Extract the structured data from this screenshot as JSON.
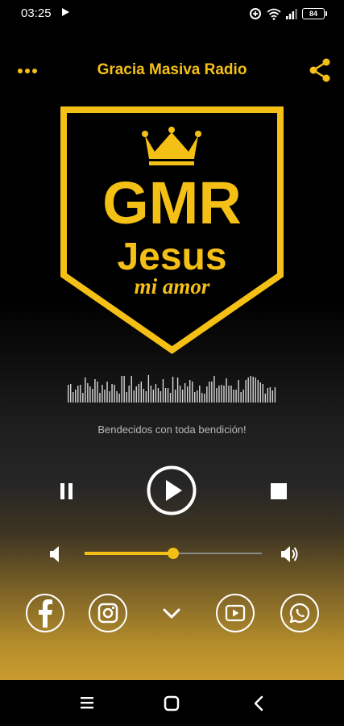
{
  "status_bar": {
    "time": "03:25",
    "battery": "84",
    "icons": [
      "media-playing-icon",
      "data-saver-icon",
      "wifi-icon",
      "signal-icon",
      "battery-icon"
    ]
  },
  "header": {
    "title": "Gracia Masiva Radio",
    "menu_icon": "more-horizontal-icon",
    "share_icon": "share-icon"
  },
  "logo": {
    "line1": "GMR",
    "line2": "Jesus",
    "line3": "mi amor"
  },
  "now_playing": {
    "message": "Bendecidos con toda bendición!"
  },
  "controls": {
    "pause_icon": "pause-icon",
    "play_icon": "play-circle-icon",
    "stop_icon": "stop-icon"
  },
  "volume": {
    "level_percent": 50
  },
  "social": [
    "facebook-icon",
    "instagram-icon",
    "chevron-down-icon",
    "youtube-icon",
    "whatsapp-icon"
  ],
  "colors": {
    "accent": "#f5c016",
    "background_top": "#000000",
    "background_bottom": "#c99c2f",
    "message_text": "#b9b9b9"
  }
}
